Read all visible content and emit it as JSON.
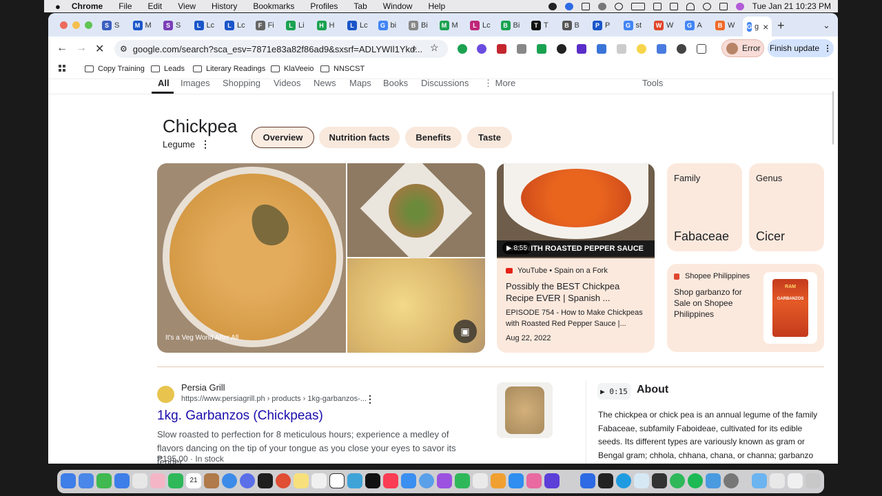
{
  "menubar": {
    "apple": "",
    "app": "Chrome",
    "items": [
      "File",
      "Edit",
      "View",
      "History",
      "Bookmarks",
      "Profiles",
      "Tab",
      "Window",
      "Help"
    ],
    "datetime": "Tue Jan 21  10:23 PM"
  },
  "tabs": [
    {
      "letter": "S",
      "label": "S",
      "color": "#3b5fc0"
    },
    {
      "letter": "M",
      "label": "M",
      "color": "#1a56c9"
    },
    {
      "letter": "S",
      "label": "S",
      "color": "#7a3fb8"
    },
    {
      "letter": "L",
      "label": "Lc",
      "color": "#1a56c9"
    },
    {
      "letter": "L",
      "label": "Lc",
      "color": "#1a56c9"
    },
    {
      "letter": "F",
      "label": "Fi",
      "color": "#666"
    },
    {
      "letter": "L",
      "label": "Li",
      "color": "#1aa251"
    },
    {
      "letter": "H",
      "label": "H",
      "color": "#1aa251"
    },
    {
      "letter": "L",
      "label": "Lc",
      "color": "#1a56c9"
    },
    {
      "letter": "G",
      "label": "bi",
      "color": "#4285f4"
    },
    {
      "letter": "B",
      "label": "Bi",
      "color": "#888"
    },
    {
      "letter": "M",
      "label": "M",
      "color": "#1aa251"
    },
    {
      "letter": "L",
      "label": "Lc",
      "color": "#c0267a"
    },
    {
      "letter": "B",
      "label": "Bi",
      "color": "#1aa251"
    },
    {
      "letter": "T",
      "label": "T",
      "color": "#111"
    },
    {
      "letter": "B",
      "label": "B",
      "color": "#555"
    },
    {
      "letter": "P",
      "label": "P",
      "color": "#1a56c9"
    },
    {
      "letter": "G",
      "label": "st",
      "color": "#4285f4"
    },
    {
      "letter": "W",
      "label": "W",
      "color": "#e0452b"
    },
    {
      "letter": "G",
      "label": "A",
      "color": "#4285f4"
    },
    {
      "letter": "B",
      "label": "W",
      "color": "#f06a29"
    }
  ],
  "active_tab": {
    "label": "g",
    "close": "×"
  },
  "new_tab": "+",
  "tab_search": "⌄",
  "toolbar": {
    "url": "google.com/search?sca_esv=7871e83a82f86ad9&sxsrf=ADLYWIl1Ykd...",
    "error_label": "Error",
    "update_label": "Finish update",
    "menu": "⋮"
  },
  "bookmarks": [
    "Copy Training",
    "Leads",
    "Literary Readings",
    "KlaVeeio",
    "NNSCST"
  ],
  "search_nav": {
    "tabs": [
      "All",
      "Images",
      "Shopping",
      "Videos",
      "News",
      "Maps",
      "Books",
      "Discussions",
      "More"
    ],
    "tools": "Tools"
  },
  "entity": {
    "title": "Chickpea",
    "subtitle": "Legume",
    "chips": [
      "Overview",
      "Nutrition facts",
      "Benefits",
      "Taste"
    ]
  },
  "image_panel": {
    "caption": "It's a Veg World After All"
  },
  "video_card": {
    "duration": "8:55",
    "banner": "EAS WITH ROASTED PEPPER SAUCE",
    "source": "YouTube • Spain on a Fork",
    "title": "Possibly the BEST Chickpea Recipe EVER | Spanish ...",
    "desc": "EPISODE 754 - How to Make Chickpeas with Roasted Red Pepper Sauce |...",
    "date": "Aug 22, 2022"
  },
  "family_card": {
    "label": "Family",
    "value": "Fabaceae"
  },
  "genus_card": {
    "label": "Genus",
    "value": "Cicer"
  },
  "shop_card": {
    "source": "Shopee Philippines",
    "text": "Shop garbanzo for Sale on Shopee Philippines",
    "can_brand": "RAM",
    "can_label": "GARBANZOS"
  },
  "result": {
    "site": "Persia Grill",
    "url": "https://www.persiagrill.ph › products › 1kg-garbanzos-...",
    "title": "1kg. Garbanzos (Chickpeas)",
    "snippet": "Slow roasted to perfection for 8 meticulous hours; experience a medley of flavors dancing on the tip of your tongue as you close your eyes to savor its tender, ...",
    "price": "₱195.00 · In stock"
  },
  "about": {
    "audio": "0:15",
    "heading": "About",
    "text": "The chickpea or chick pea is an annual legume of the family Fabaceae, subfamily Faboideae, cultivated for its edible seeds. Its different types are variously known as gram or Bengal gram; chhola, chhana, chana, or channa; garbanzo"
  }
}
